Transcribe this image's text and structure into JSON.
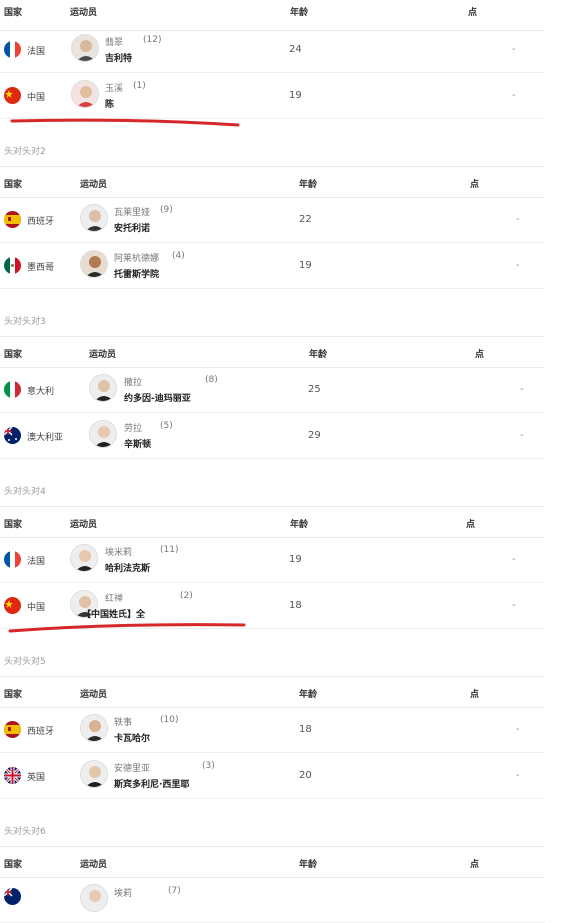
{
  "headers": {
    "country": "国家",
    "athlete": "运动员",
    "age": "年龄",
    "points": "点"
  },
  "colors": {
    "highlight_line": "#d62828"
  },
  "sections": [
    {
      "title": "",
      "rows": [
        {
          "flag": "france",
          "country": "法国",
          "given": "翡翠",
          "seed": "(12)",
          "family": "吉利特",
          "age": "24",
          "points": "-"
        },
        {
          "flag": "china",
          "country": "中国",
          "given": "玉溪",
          "seed": "(1)",
          "family": "陈",
          "age": "19",
          "points": "-"
        }
      ]
    },
    {
      "title": "头对头对2",
      "rows": [
        {
          "flag": "spain",
          "country": "西班牙",
          "given": "瓦莱里娅",
          "seed": "(9)",
          "family": "安托利诺",
          "age": "22",
          "points": "-"
        },
        {
          "flag": "mexico",
          "country": "墨西哥",
          "given": "阿莱杭德娜",
          "seed": "(4)",
          "family": "托雷斯学院",
          "age": "19",
          "points": "-"
        }
      ]
    },
    {
      "title": "头对头对3",
      "rows": [
        {
          "flag": "italy",
          "country": "意大利",
          "given": "撒拉",
          "seed": "(8)",
          "family": "约多因-迪玛丽亚",
          "age": "25",
          "points": "-"
        },
        {
          "flag": "australia",
          "country": "澳大利亚",
          "given": "劳拉",
          "seed": "(5)",
          "family": "辛斯顿",
          "age": "29",
          "points": "-"
        }
      ]
    },
    {
      "title": "头对头对4",
      "rows": [
        {
          "flag": "france",
          "country": "法国",
          "given": "埃米莉",
          "seed": "(11)",
          "family": "哈利法克斯",
          "age": "19",
          "points": "-"
        },
        {
          "flag": "china",
          "country": "中国",
          "given": "红禅",
          "seed": "(2)",
          "family": "【中国姓氏】全",
          "age": "18",
          "points": "-"
        }
      ]
    },
    {
      "title": "头对头对5",
      "rows": [
        {
          "flag": "spain",
          "country": "西班牙",
          "given": "轶事",
          "seed": "(10)",
          "family": "卡瓦哈尔",
          "age": "18",
          "points": "-"
        },
        {
          "flag": "uk",
          "country": "英国",
          "given": "安德里亚",
          "seed": "(3)",
          "family": "斯宾多利尼·西里耶",
          "age": "20",
          "points": "-"
        }
      ]
    },
    {
      "title": "头对头对6",
      "rows": [
        {
          "flag": "australia",
          "country": "",
          "given": "埃莉",
          "seed": "(7)",
          "family": "",
          "age": "",
          "points": ""
        }
      ]
    }
  ]
}
